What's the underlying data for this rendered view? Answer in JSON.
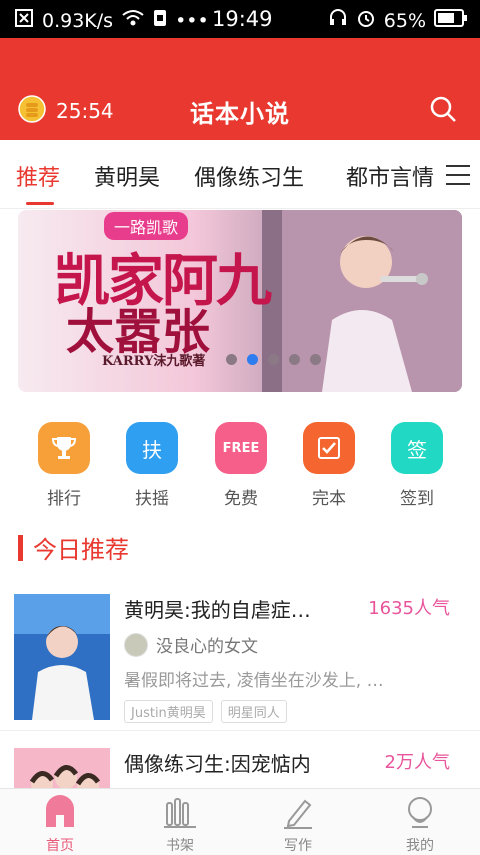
{
  "status_bar": {
    "network_speed": "0.93K/s",
    "time": "19:49",
    "battery": "65%"
  },
  "app_bar": {
    "timer": "25:54",
    "title": "话本小说"
  },
  "tabs": [
    {
      "label": "推荐"
    },
    {
      "label": "黄明昊"
    },
    {
      "label": "偶像练习生"
    },
    {
      "label": "都市言情"
    }
  ],
  "banner": {
    "line1": "一路凯歌",
    "line2": "凯家阿九",
    "line3": "太嚣张",
    "author": "KARRY沫九歌著",
    "page_count": 5,
    "active_page_index": 1
  },
  "quick_actions": [
    {
      "label": "排行",
      "icon": "trophy-icon",
      "color": "#f7a03a"
    },
    {
      "label": "扶摇",
      "icon": "fu-icon",
      "color": "#2f9ff2",
      "glyph": "扶"
    },
    {
      "label": "免费",
      "icon": "free-icon",
      "color": "#f55f8a",
      "glyph": "FREE"
    },
    {
      "label": "完本",
      "icon": "complete-icon",
      "color": "#f4652f"
    },
    {
      "label": "签到",
      "icon": "checkin-icon",
      "color": "#20d8c3",
      "glyph": "签"
    }
  ],
  "section_title": "今日推荐",
  "books": [
    {
      "title": "黄明昊:我的自虐症…",
      "popularity": "1635人气",
      "author": "没良心的女文",
      "desc": "暑假即将过去, 凌倩坐在沙发上, …",
      "tags": [
        "Justin黄明昊",
        "明星同人"
      ]
    },
    {
      "title": "偶像练习生:因宠惦内",
      "popularity": "2万人气"
    }
  ],
  "bottom_nav": [
    {
      "label": "首页",
      "icon": "home-icon"
    },
    {
      "label": "书架",
      "icon": "bookshelf-icon"
    },
    {
      "label": "写作",
      "icon": "pen-icon"
    },
    {
      "label": "我的",
      "icon": "profile-icon"
    }
  ],
  "colors": {
    "brand": "#e8382f",
    "popularity": "#e8559b",
    "nav_active": "#e85a7a"
  }
}
